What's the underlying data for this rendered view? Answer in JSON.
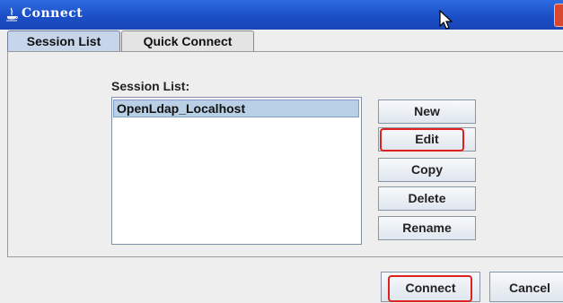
{
  "window": {
    "title": "Connect"
  },
  "tabs": [
    {
      "label": "Session List",
      "active": true
    },
    {
      "label": "Quick Connect",
      "active": false
    }
  ],
  "session_list": {
    "label": "Session List:",
    "items": [
      {
        "name": "OpenLdap_Localhost",
        "selected": true
      }
    ]
  },
  "side_buttons": {
    "new": "New",
    "edit": "Edit",
    "copy": "Copy",
    "delete": "Delete",
    "rename": "Rename"
  },
  "footer": {
    "connect": "Connect",
    "cancel": "Cancel"
  },
  "colors": {
    "titlebar": "#1b4fc7",
    "selection": "#b8cfe5",
    "highlight": "#e0201c"
  }
}
